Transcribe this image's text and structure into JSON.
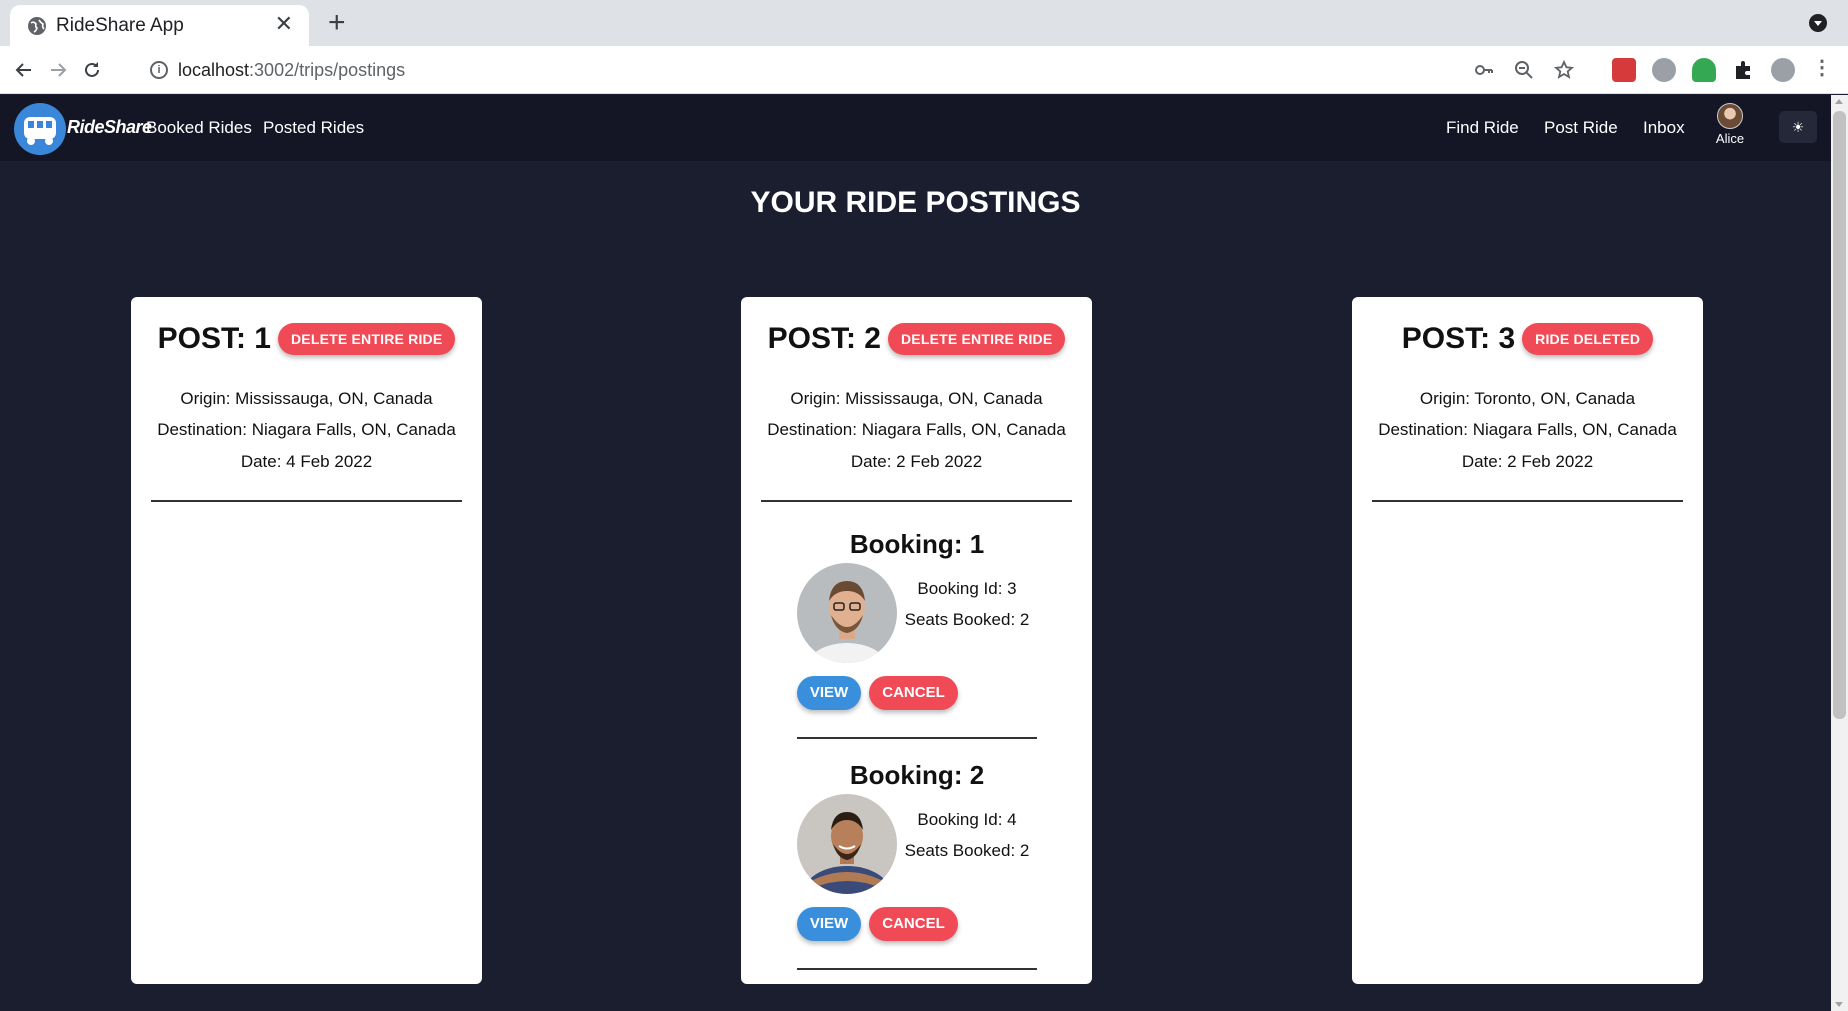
{
  "browser": {
    "tab_title": "RideShare App",
    "tab_close": "✕",
    "new_tab": "+",
    "url_host": "localhost",
    "url_path": ":3002/trips/postings"
  },
  "app": {
    "brand": "RideShare",
    "nav_left": [
      "Booked Rides",
      "Posted Rides"
    ],
    "nav_right": [
      "Find Ride",
      "Post Ride",
      "Inbox"
    ],
    "user_name": "Alice",
    "theme_icon": "☀"
  },
  "page_title": "YOUR RIDE POSTINGS",
  "posts": [
    {
      "label": "POST: 1",
      "action": "DELETE ENTIRE RIDE",
      "origin": "Origin: Mississauga, ON, Canada",
      "destination": "Destination: Niagara Falls, ON, Canada",
      "date": "Date: 4 Feb 2022"
    },
    {
      "label": "POST: 2",
      "action": "DELETE ENTIRE RIDE",
      "origin": "Origin: Mississauga, ON, Canada",
      "destination": "Destination: Niagara Falls, ON, Canada",
      "date": "Date: 2 Feb 2022",
      "bookings": [
        {
          "title": "Booking: 1",
          "booking_id": "Booking Id: 3",
          "seats": "Seats Booked: 2",
          "view": "VIEW",
          "cancel": "CANCEL"
        },
        {
          "title": "Booking: 2",
          "booking_id": "Booking Id: 4",
          "seats": "Seats Booked: 2",
          "view": "VIEW",
          "cancel": "CANCEL"
        }
      ]
    },
    {
      "label": "POST: 3",
      "action": "RIDE DELETED",
      "origin": "Origin: Toronto, ON, Canada",
      "destination": "Destination: Niagara Falls, ON, Canada",
      "date": "Date: 2 Feb 2022"
    }
  ],
  "colors": {
    "page_bg": "#1b1e2e",
    "nav_bg": "#141625",
    "danger": "#ef4a56",
    "primary": "#3a8fdc"
  }
}
